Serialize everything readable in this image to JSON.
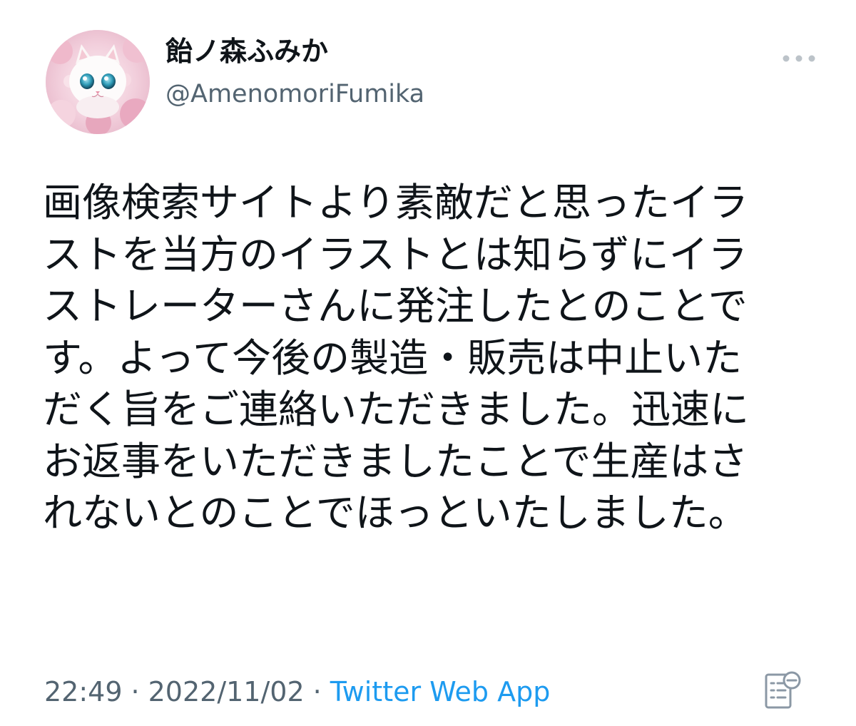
{
  "author": {
    "display_name": "飴ノ森ふみか",
    "handle": "@AmenomoriFumika"
  },
  "tweet": {
    "lines": [
      "画像検索サイトより素敵だと思ったイラ",
      "ストを当方のイラストとは知らずにイラ",
      "ストレーターさんに発注したとのことで",
      "す。よって今後の製造・販売は中止いた",
      "だく旨をご連絡いただきました。迅速に",
      "お返事をいただきましたことで生産はさ",
      "れないとのことでほっといたしました。"
    ]
  },
  "meta": {
    "time": "22:49",
    "separator": "·",
    "date": "2022/11/02",
    "source": "Twitter Web App"
  },
  "icons": {
    "more": "more-dots-icon",
    "view_details": "document-list-icon",
    "avatar": "kitten-avatar-image"
  },
  "colors": {
    "text_primary": "#0f1419",
    "text_secondary": "#536471",
    "link": "#1d9bf0",
    "background": "#ffffff"
  }
}
